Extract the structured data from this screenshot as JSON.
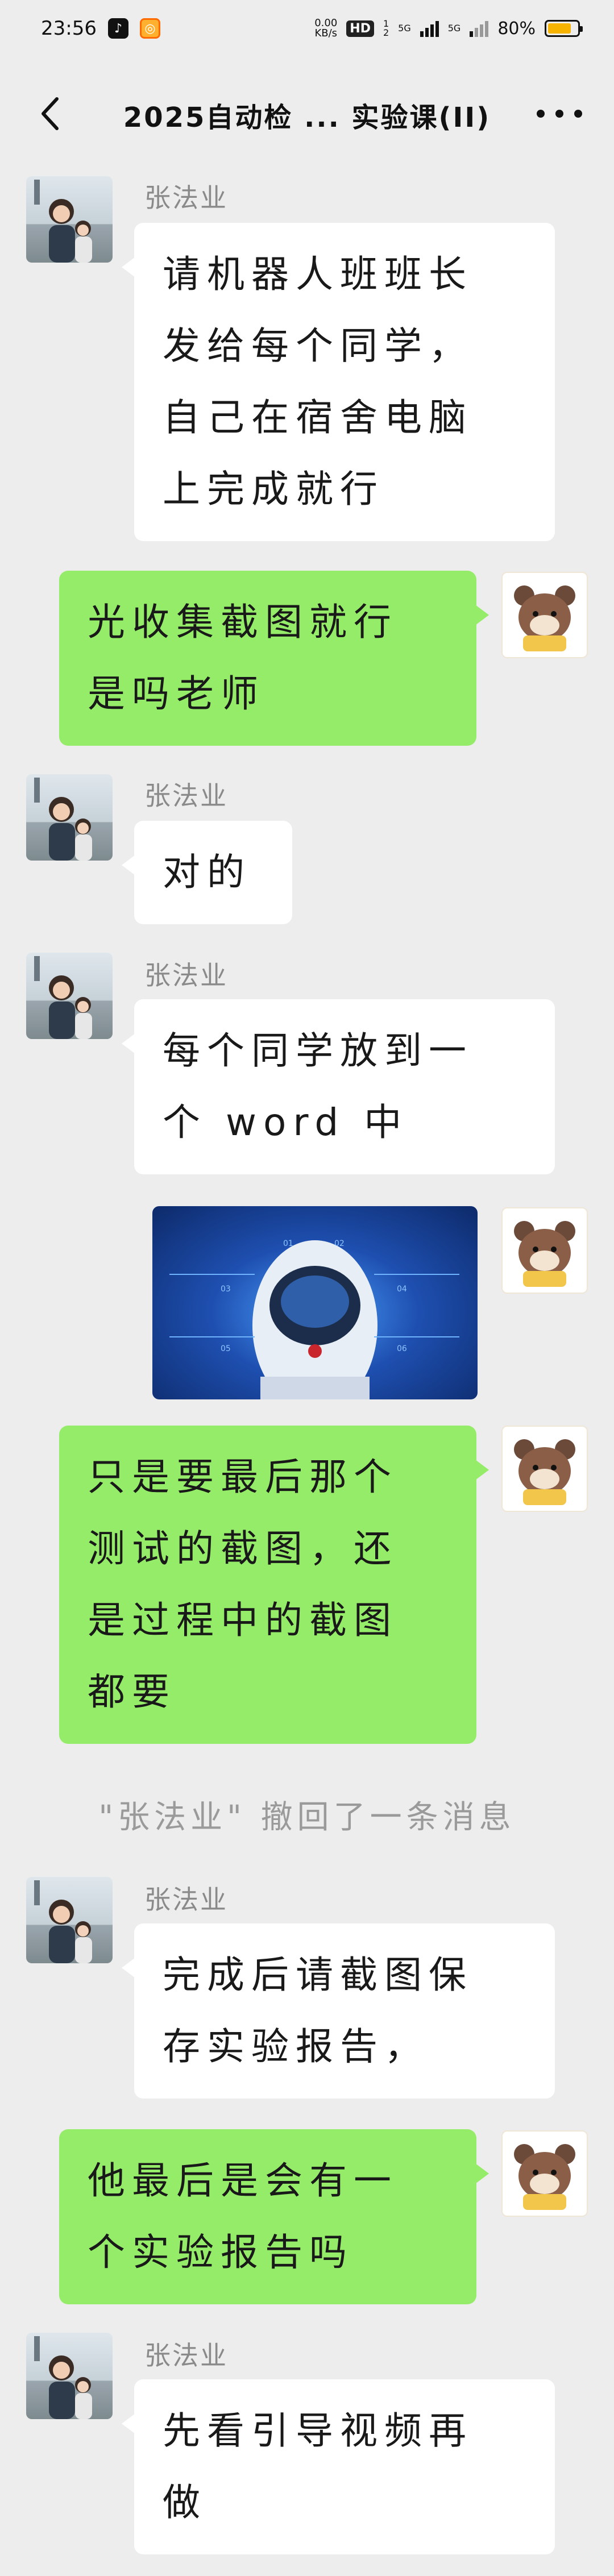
{
  "status_bar": {
    "time": "23:56",
    "net_speed_value": "0.00",
    "net_speed_unit": "KB/s",
    "hd_badge": "HD",
    "hd_sub_top": "1",
    "hd_sub_bottom": "2",
    "signal1_label": "5G",
    "signal2_label": "5G",
    "battery_percent": "80%",
    "battery_level": 0.8,
    "app_icons": [
      "tiktok-icon",
      "app-notification-icon"
    ]
  },
  "header": {
    "title": "2025自动检 ... 实验课(II)",
    "back_icon": "chevron-left-icon",
    "more_icon": "more-horizontal-icon"
  },
  "messages": [
    {
      "type": "in",
      "sender": "张法业",
      "text": "请机器人班班长\n发给每个同学，\n自己在宿舍电脑\n上完成就行"
    },
    {
      "type": "out",
      "text": "光收集截图就行\n是吗老师"
    },
    {
      "type": "in",
      "sender": "张法业",
      "text": "对的"
    },
    {
      "type": "in",
      "sender": "张法业",
      "text": "每个同学放到一\n个 word 中"
    },
    {
      "type": "out-image",
      "image_labels": [
        "01",
        "02",
        "03",
        "04",
        "05",
        "06"
      ]
    },
    {
      "type": "out",
      "text": "只是要最后那个\n测试的截图，还\n是过程中的截图\n都要"
    },
    {
      "type": "system",
      "text": "\"张法业\" 撤回了一条消息"
    },
    {
      "type": "in",
      "sender": "张法业",
      "text": "完成后请截图保\n存实验报告，"
    },
    {
      "type": "out",
      "text": "他最后是会有一\n个实验报告吗"
    },
    {
      "type": "in",
      "sender": "张法业",
      "text": "先看引导视频再\n做"
    }
  ],
  "colors": {
    "background": "#ededed",
    "incoming_bubble": "#ffffff",
    "outgoing_bubble": "#95ec69",
    "sender_name": "#8a8a8a"
  }
}
